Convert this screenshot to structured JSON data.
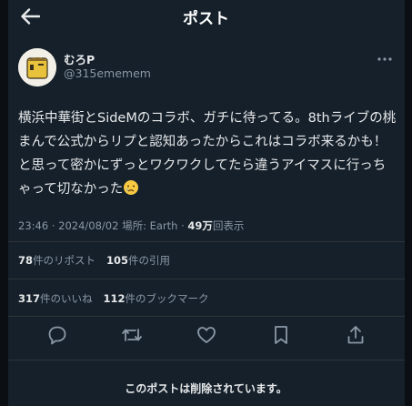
{
  "header": {
    "title": "ポスト"
  },
  "post": {
    "author_name": "むろP",
    "handle": "@315ememem",
    "text": "横浜中華街とSideMのコラボ、ガチに待ってる。8thライブの桃まんで公式からリプと認知あったからこれはコラボ来るかも！と思って密かにずっとワクワクしてたら違うアイマスに行っちゃって切なかった",
    "emoji": "sad-face-with-tear"
  },
  "meta": {
    "time": "23:46",
    "sep1": " · ",
    "date": "2024/08/02",
    "location": " 場所: Earth",
    "sep2": " · ",
    "views_count": "49万",
    "views_label": "回表示"
  },
  "stats": {
    "reposts_count": "78",
    "reposts_label": "件のリポスト",
    "quotes_count": "105",
    "quotes_label": "件の引用",
    "likes_count": "317",
    "likes_label": "件のいいね",
    "bookmarks_count": "112",
    "bookmarks_label": "件のブックマーク"
  },
  "actions": [
    "reply-icon",
    "repost-icon",
    "like-icon",
    "bookmark-icon",
    "share-icon"
  ],
  "notice": {
    "deleted": "このポストは削除されています。"
  },
  "colors": {
    "background": "#15202b",
    "outer": "#0b0f13",
    "text": "#e7e9ea",
    "muted": "#8b98a5",
    "border": "#2f3336"
  }
}
